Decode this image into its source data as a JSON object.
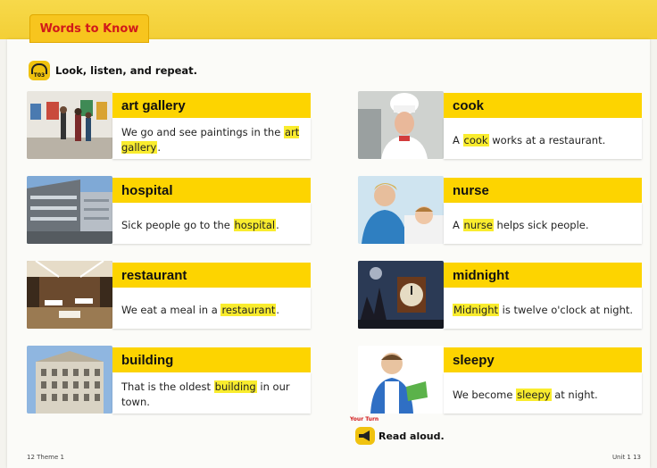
{
  "header": {
    "tab": "Words to Know"
  },
  "instruction": {
    "text": "Look, listen, and repeat.",
    "track": "T03"
  },
  "cards": [
    {
      "word": "art gallery",
      "before": "We go and see paintings in the ",
      "highlight": "art gallery",
      "after": ".",
      "image": "gallery-photo"
    },
    {
      "word": "cook",
      "before": "A ",
      "highlight": "cook",
      "after": " works at a restaurant.",
      "image": "chef-photo"
    },
    {
      "word": "hospital",
      "before": "Sick people go to the ",
      "highlight": "hospital",
      "after": ".",
      "image": "hospital-photo"
    },
    {
      "word": "nurse",
      "before": "A ",
      "highlight": "nurse",
      "after": " helps sick people.",
      "image": "nurse-photo"
    },
    {
      "word": "restaurant",
      "before": "We eat a meal in a ",
      "highlight": "restaurant",
      "after": ".",
      "image": "restaurant-photo"
    },
    {
      "word": "midnight",
      "before": "",
      "highlight": "Midnight",
      "after": " is twelve o'clock at night.",
      "image": "clock-photo"
    },
    {
      "word": "building",
      "before": "That is the oldest ",
      "highlight": "building",
      "after": " in our town.",
      "image": "building-photo"
    },
    {
      "word": "sleepy",
      "before": "We become ",
      "highlight": "sleepy",
      "after": " at night.",
      "image": "sleepy-boy-photo"
    }
  ],
  "footer": {
    "your_turn": "Your Turn",
    "read_aloud": "Read aloud.",
    "left_page": "12 Theme 1",
    "right_page": "Unit 1 13"
  }
}
